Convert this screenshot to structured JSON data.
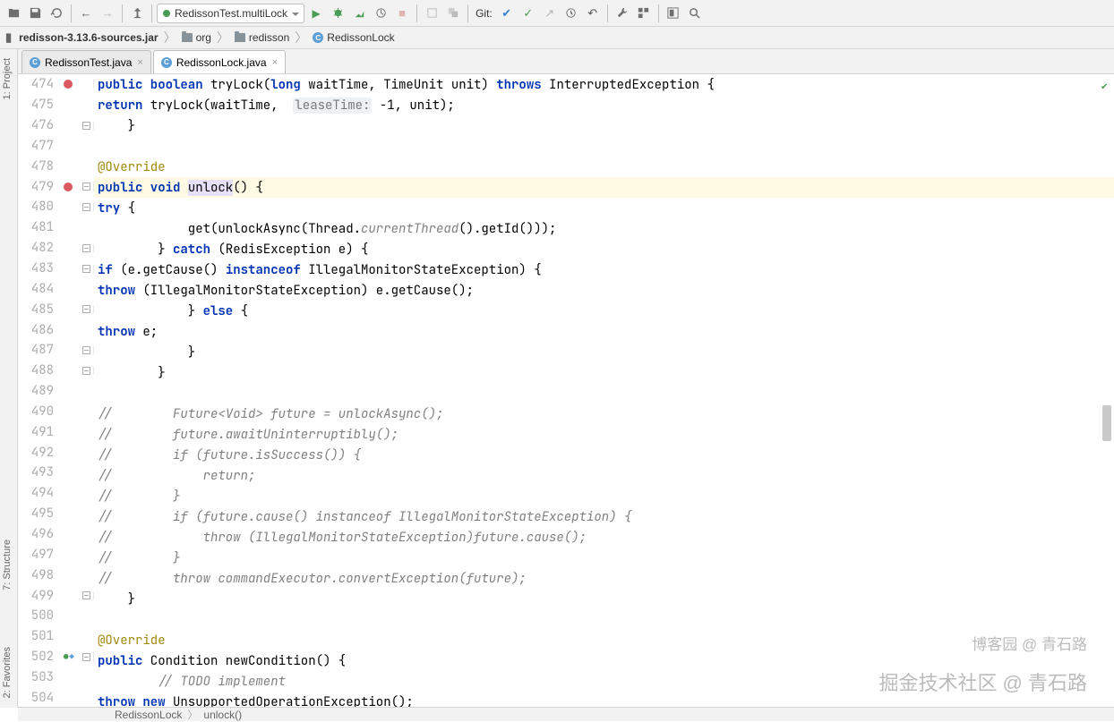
{
  "toolbar": {
    "run_config": "RedissonTest.multiLock",
    "git_label": "Git:"
  },
  "nav": {
    "root": "redisson-3.13.6-sources.jar",
    "org": "org",
    "redisson": "redisson",
    "class": "RedissonLock"
  },
  "tabs": [
    {
      "label": "RedissonTest.java",
      "active": false
    },
    {
      "label": "RedissonLock.java",
      "active": true
    }
  ],
  "crumbs": {
    "c1": "RedissonLock",
    "c2": "unlock()"
  },
  "watermark1": "博客园 @ 青石路",
  "watermark2": "掘金技术社区 @ 青石路",
  "code": {
    "l474": {
      "num": "474",
      "sig_pre": "public boolean",
      "sig_mid": " tryLock(",
      "sig_long": "long",
      "sig_rest": " waitTime, TimeUnit unit) ",
      "throws": "throws",
      "exc": " InterruptedException {"
    },
    "l475": {
      "num": "475",
      "ret": "return",
      "body": " tryLock(waitTime,  ",
      "hint": "leaseTime:",
      "tail": " -1, unit);"
    },
    "l476": {
      "num": "476",
      "body": "    }"
    },
    "l477": {
      "num": "477"
    },
    "l478": {
      "num": "478",
      "ann": "@Override"
    },
    "l479": {
      "num": "479",
      "pv": "public void ",
      "m": "unlock",
      "tail": "() {"
    },
    "l480": {
      "num": "480",
      "try": "try",
      "tail": " {"
    },
    "l481": {
      "num": "481",
      "pre": "            get(unlockAsync(Thread.",
      "it": "currentThread",
      "post": "().getId()));"
    },
    "l482": {
      "num": "482",
      "pre": "        } ",
      "catch": "catch",
      "post": " (RedisException e) {"
    },
    "l483": {
      "num": "483",
      "if": "if",
      "pre": " (e.getCause() ",
      "io": "instanceof",
      "post": " IllegalMonitorStateException) {"
    },
    "l484": {
      "num": "484",
      "throw": "throw",
      "post": " (IllegalMonitorStateException) e.getCause();"
    },
    "l485": {
      "num": "485",
      "pre": "            } ",
      "else": "else",
      "post": " {"
    },
    "l486": {
      "num": "486",
      "throw": "throw",
      "post": " e;"
    },
    "l487": {
      "num": "487",
      "body": "            }"
    },
    "l488": {
      "num": "488",
      "body": "        }"
    },
    "l489": {
      "num": "489"
    },
    "l490": {
      "num": "490",
      "c": "//        Future<Void> future = unlockAsync();"
    },
    "l491": {
      "num": "491",
      "c": "//        future.awaitUninterruptibly();"
    },
    "l492": {
      "num": "492",
      "c": "//        if (future.isSuccess()) {"
    },
    "l493": {
      "num": "493",
      "c": "//            return;"
    },
    "l494": {
      "num": "494",
      "c": "//        }"
    },
    "l495": {
      "num": "495",
      "c": "//        if (future.cause() instanceof IllegalMonitorStateException) {"
    },
    "l496": {
      "num": "496",
      "c": "//            throw (IllegalMonitorStateException)future.cause();"
    },
    "l497": {
      "num": "497",
      "c": "//        }"
    },
    "l498": {
      "num": "498",
      "c": "//        throw commandExecutor.convertException(future);"
    },
    "l499": {
      "num": "499",
      "body": "    }"
    },
    "l500": {
      "num": "500"
    },
    "l501": {
      "num": "501",
      "ann": "@Override"
    },
    "l502": {
      "num": "502",
      "pub": "public",
      "post": " Condition newCondition() {"
    },
    "l503": {
      "num": "503",
      "c": "        // TODO implement"
    },
    "l504": {
      "num": "504",
      "throw": "throw",
      "new": " new",
      "post": " UnsupportedOperationException();"
    }
  }
}
